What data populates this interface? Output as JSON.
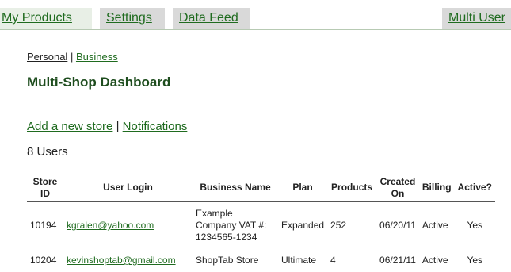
{
  "tabs": {
    "my_products": "My Products",
    "settings": "Settings",
    "data_feed": "Data Feed",
    "multi_user": "Multi User"
  },
  "toggle": {
    "personal": "Personal",
    "separator": "|",
    "business": "Business"
  },
  "title": "Multi-Shop Dashboard",
  "links": {
    "add_store": "Add a new store",
    "separator": "|",
    "notifications": "Notifications"
  },
  "user_count": "8 Users",
  "table": {
    "headers": {
      "store_id": "Store ID",
      "user_login": "User Login",
      "business_name": "Business Name",
      "plan": "Plan",
      "products": "Products",
      "created_on": "Created On",
      "billing": "Billing",
      "active": "Active?"
    },
    "rows": [
      {
        "store_id": "10194",
        "user_login": "kgralen@yahoo.com",
        "business_name_line1": "Example",
        "business_name_line2": "Company VAT #:",
        "business_name_line3": "1234565-1234",
        "plan": "Expanded",
        "products": "252",
        "created_on": "06/20/11",
        "billing": "Active",
        "active": "Yes"
      },
      {
        "store_id": "10204",
        "user_login": "kevinshoptab@gmail.com",
        "business_name": "ShopTab Store",
        "plan": "Ultimate",
        "products": "4",
        "created_on": "06/21/11",
        "billing": "Active",
        "active": "Yes"
      }
    ]
  },
  "colors": {
    "link_green": "#1f6b1f",
    "title_green": "#1e4d1e",
    "tab_gray": "#d9d9d9"
  }
}
